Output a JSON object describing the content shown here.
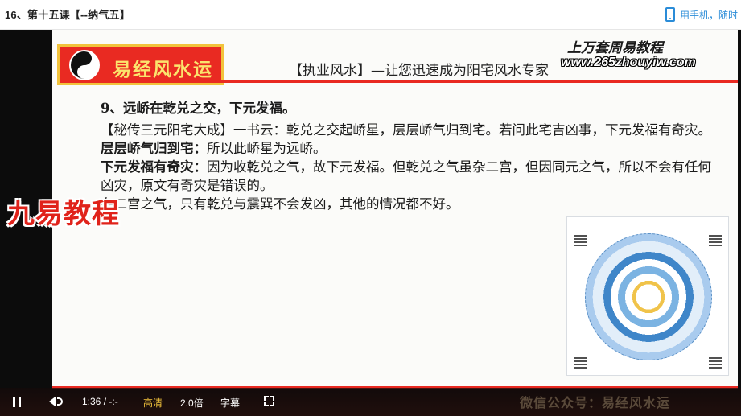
{
  "header": {
    "title": "16、第十五课【--纳气五】",
    "phone_label": "用手机，随时"
  },
  "slide": {
    "logo_text": "易经风水运",
    "subtitle": "【执业风水】—让您迅速成为阳宅风水专家",
    "banner_line1": "上万套周易教程",
    "banner_line2": "www.265zhouyiw.com",
    "watermark_left": "九易教程",
    "wechat": "微信公众号：易经风水运",
    "content": {
      "heading": "9、远峤在乾兑之交，下元发福。",
      "p1": "【秘传三元阳宅大成】一书云：乾兑之交起峤星，层层峤气归到宅。若问此宅吉凶事，下元发福有奇灾。",
      "p2_bold": "层层峤气归到宅：",
      "p2_rest": "所以此峤星为远峤。",
      "p3_bold": "下元发福有奇灾：",
      "p3_rest": "因为收乾兑之气，故下元发福。但乾兑之气虽杂二宫，但因同元之气，所以不会有任何凶灾，原文有奇灾是错误的。",
      "p4": "杂二宫之气，只有乾兑与震巽不会发凶，其他的情况都不好。"
    }
  },
  "controls": {
    "time": "1:36 / -:-",
    "quality": "高清",
    "speed": "2.0倍",
    "subtitles": "字幕"
  },
  "colors": {
    "accent_red": "#e92a22",
    "logo_gold": "#f2c33c",
    "link_blue": "#2a8cd8"
  }
}
